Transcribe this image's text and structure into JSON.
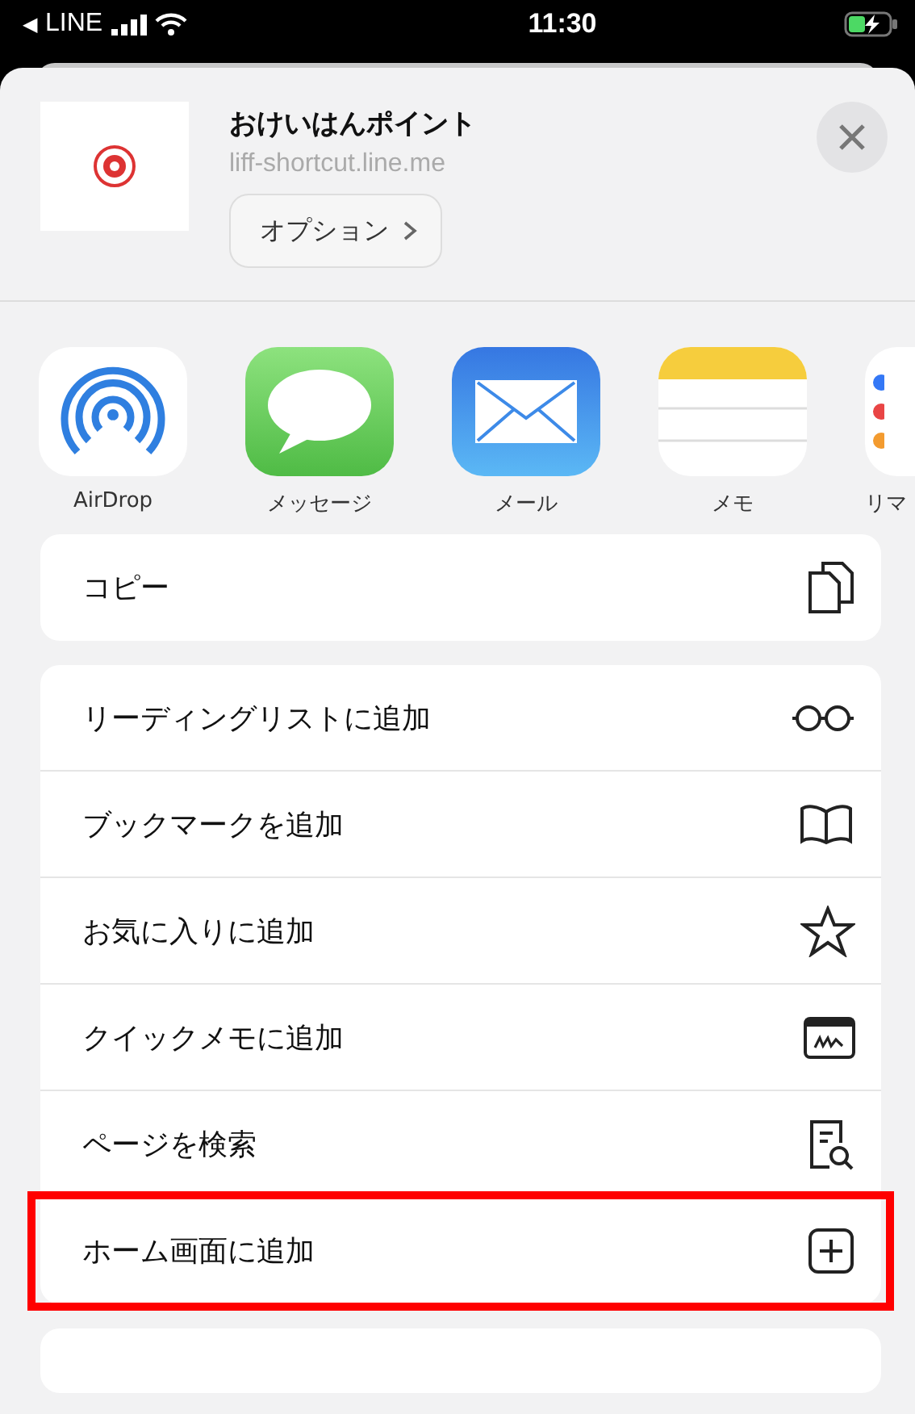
{
  "status_bar": {
    "back": "◀",
    "app": "LINE",
    "time": "11:30"
  },
  "header": {
    "title": "おけいはんポイント",
    "url": "liff-shortcut.line.me",
    "options_button": "オプション"
  },
  "apps": [
    {
      "label": "AirDrop"
    },
    {
      "label": "メッセージ"
    },
    {
      "label": "メール"
    },
    {
      "label": "メモ"
    },
    {
      "label": "リマ"
    }
  ],
  "copy_group": [
    {
      "label": "コピー",
      "highlighted": false
    }
  ],
  "actions": [
    {
      "label": "リーディングリストに追加",
      "highlighted": false
    },
    {
      "label": "ブックマークを追加",
      "highlighted": false
    },
    {
      "label": "お気に入りに追加",
      "highlighted": false
    },
    {
      "label": "クイックメモに追加",
      "highlighted": false
    },
    {
      "label": "ページを検索",
      "highlighted": false
    },
    {
      "label": "ホーム画面に追加",
      "highlighted": true
    }
  ]
}
